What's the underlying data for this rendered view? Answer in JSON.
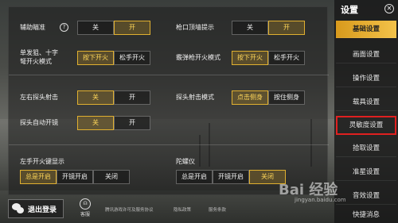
{
  "settings": {
    "aim_assist": {
      "label": "辅助瞄准",
      "help": "?",
      "options": [
        "关",
        "开"
      ],
      "selected": 1
    },
    "muzzle_tip": {
      "label": "枪口顶墙提示",
      "options": [
        "关",
        "开"
      ],
      "selected": 1
    },
    "single_fire": {
      "label_line1": "单发狙、十字",
      "label_line2": "弩开火模式",
      "options": [
        "按下开火",
        "松手开火"
      ],
      "selected": 0
    },
    "shotgun_fire": {
      "label": "霰弹枪开火模式",
      "options": [
        "按下开火",
        "松手开火"
      ],
      "selected": 0
    },
    "peek": {
      "label": "左右探头射击",
      "options": [
        "关",
        "开"
      ],
      "selected": 0
    },
    "peek_mode": {
      "label": "探头射击模式",
      "options": [
        "点击侧身",
        "按住侧身"
      ],
      "selected": 0
    },
    "peek_scope": {
      "label": "探头自动开镜",
      "options": [
        "关",
        "开"
      ],
      "selected": 0
    },
    "left_fire": {
      "label": "左手开火键显示",
      "options": [
        "总是开启",
        "开镜开启",
        "关闭"
      ],
      "selected": 0
    },
    "gyro": {
      "label": "陀螺仪",
      "options": [
        "总是开启",
        "开镜开启",
        "关闭"
      ],
      "selected": 2
    }
  },
  "sidebar": {
    "title": "设置",
    "items": [
      {
        "label": "基础设置"
      },
      {
        "label": "画面设置"
      },
      {
        "label": "操作设置"
      },
      {
        "label": "载具设置"
      },
      {
        "label": "灵敏度设置"
      },
      {
        "label": "拾取设置"
      },
      {
        "label": "准星设置"
      },
      {
        "label": "音效设置"
      },
      {
        "label": "快捷消息"
      }
    ]
  },
  "footer": {
    "logout": "退出登录",
    "service": "客服",
    "links": [
      "腾讯游戏许可及服务协议",
      "隐私政策",
      "服务条款"
    ]
  },
  "watermark": {
    "text": "Bai 经验",
    "sub": "jingyan.baidu.com"
  }
}
